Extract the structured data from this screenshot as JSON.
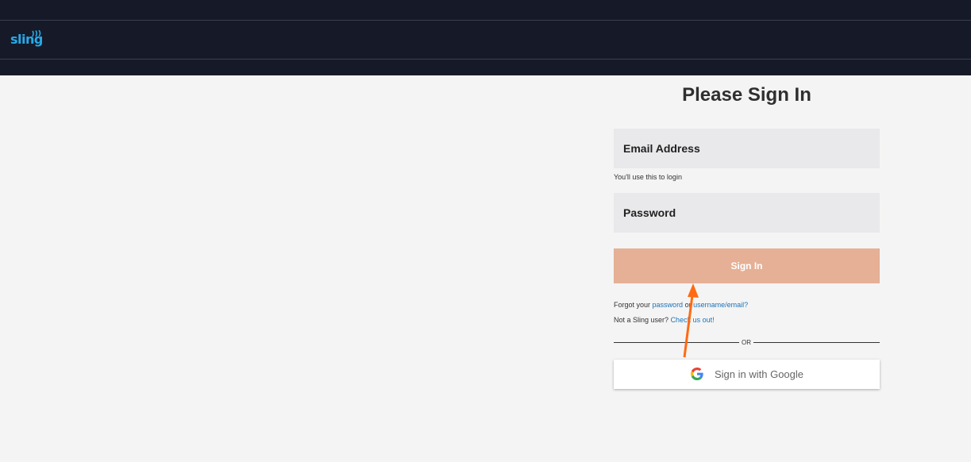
{
  "header": {
    "logo_text": "sling"
  },
  "signin": {
    "title": "Please Sign In",
    "email_placeholder": "Email Address",
    "email_hint": "You'll use this to login",
    "password_placeholder": "Password",
    "signin_button": "Sign In",
    "forgot_prefix": "Forgot your",
    "forgot_password_link": "password",
    "forgot_or": "or",
    "forgot_username_link": "username/email?",
    "not_user_prefix": "Not a Sling user?",
    "check_link": "Check us out!",
    "divider_text": "OR",
    "google_button": "Sign in with Google"
  },
  "colors": {
    "header_bg": "#161a28",
    "logo": "#27a9e8",
    "signin_button_bg": "#e5b095",
    "link": "#1a73b8",
    "annotation_arrow": "#ff6a13"
  },
  "icons": {
    "logo_waves": "signal-waves-icon",
    "google": "google-g-icon",
    "annotation": "arrow-annotation-icon"
  }
}
